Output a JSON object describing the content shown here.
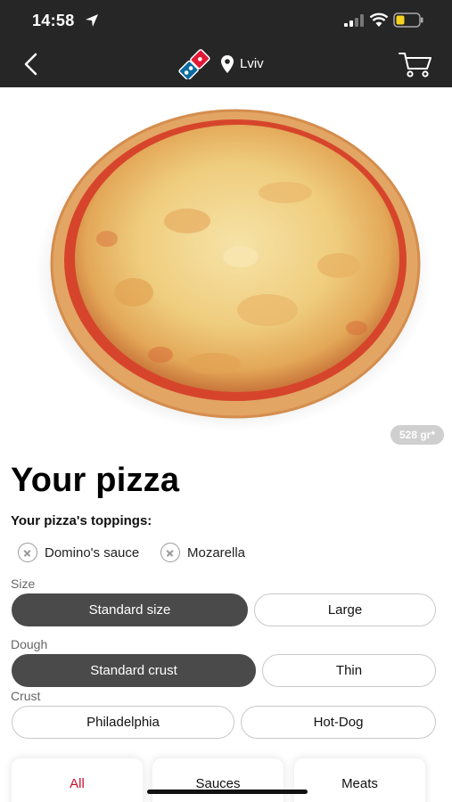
{
  "status_bar": {
    "time": "14:58"
  },
  "nav": {
    "location": "Lviv",
    "icons": [
      "back-chevron-icon",
      "dominos-logo",
      "location-pin-icon",
      "cart-icon"
    ]
  },
  "product": {
    "weight": "528 gr*",
    "title": "Your pizza",
    "toppings_label": "Your pizza's toppings:",
    "toppings": [
      "Domino's sauce",
      "Mozarella"
    ]
  },
  "options": {
    "size": {
      "label": "Size",
      "choices": [
        "Standard size",
        "Large"
      ],
      "selected": "Standard size"
    },
    "dough": {
      "label": "Dough",
      "choices": [
        "Standard crust",
        "Thin"
      ],
      "selected": "Standard crust"
    },
    "crust": {
      "label": "Crust",
      "choices": [
        "Philadelphia",
        "Hot-Dog"
      ],
      "selected": ""
    }
  },
  "categories": {
    "items": [
      "All",
      "Sauces",
      "Meats"
    ],
    "active": "All"
  },
  "colors": {
    "topbar": "#262626",
    "selected_pill": "#4a4a4a",
    "active_category": "#c8102e",
    "logo_blue": "#0b6aa2",
    "logo_red": "#e31837"
  }
}
